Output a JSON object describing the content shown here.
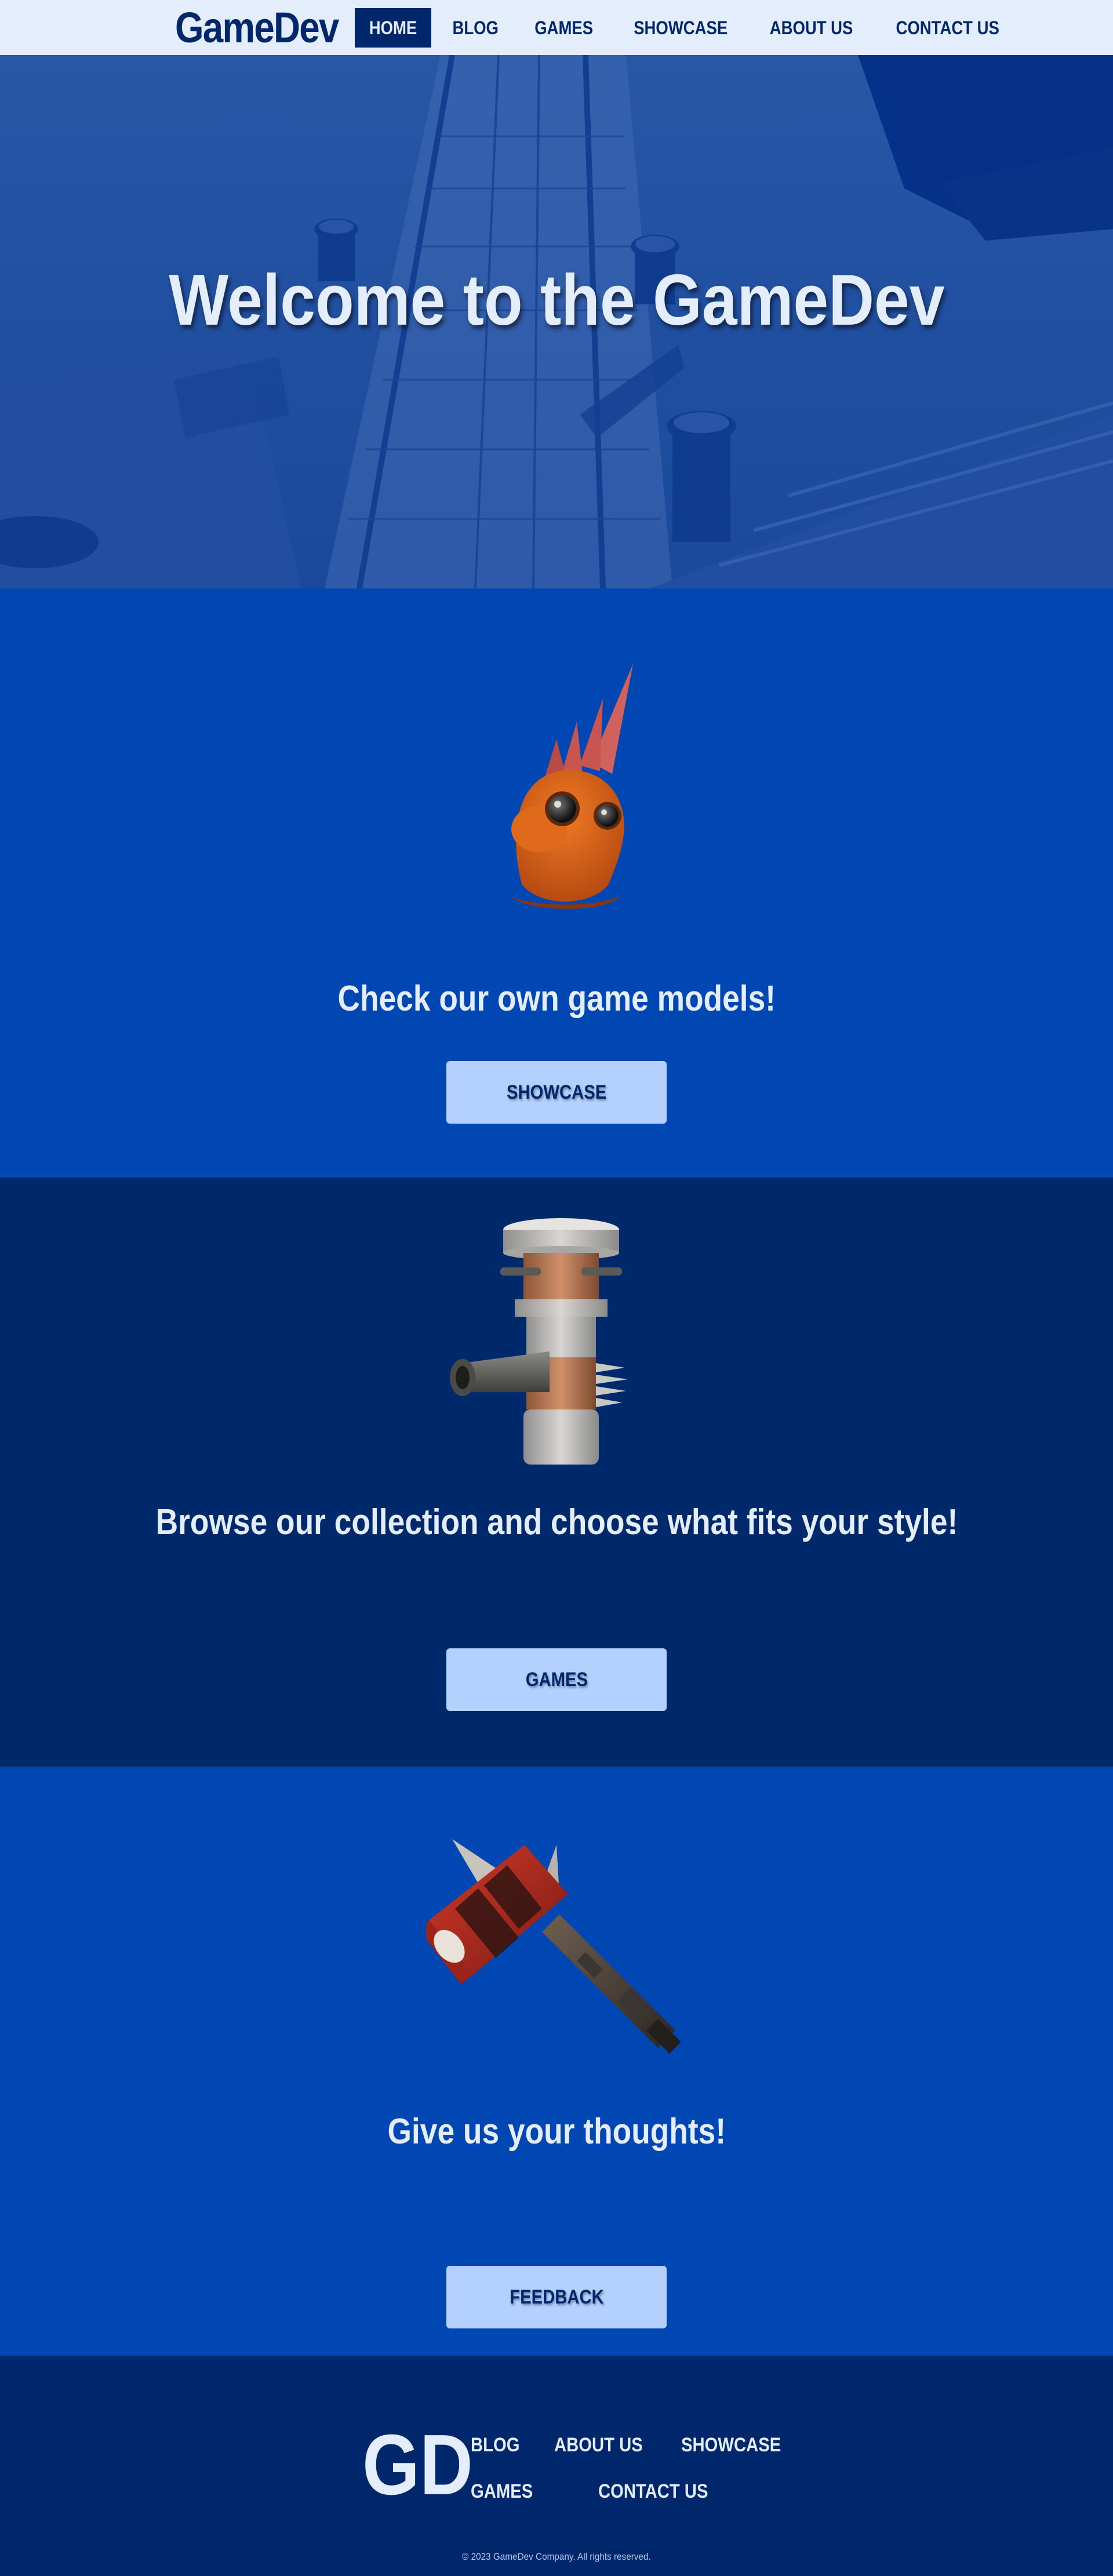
{
  "brand": {
    "logo": "GameDev",
    "footer_logo": "GD"
  },
  "nav": {
    "items": [
      {
        "label": "HOME",
        "active": true
      },
      {
        "label": "BLOG",
        "active": false
      },
      {
        "label": "GAMES",
        "active": false
      },
      {
        "label": "SHOWCASE",
        "active": false
      },
      {
        "label": "ABOUT US",
        "active": false
      },
      {
        "label": "CONTACT US",
        "active": false
      }
    ]
  },
  "hero": {
    "title": "Welcome to the GameDev"
  },
  "sections": [
    {
      "heading": "Check our own game models!",
      "button": "SHOWCASE",
      "model_icon": "orange-creature-icon"
    },
    {
      "heading": "Browse our collection and choose what fits your style!",
      "button": "GAMES",
      "model_icon": "cannon-tower-icon"
    },
    {
      "heading": "Give us your thoughts!",
      "button": "FEEDBACK",
      "model_icon": "spiked-hammer-icon"
    }
  ],
  "footer": {
    "links": [
      "BLOG",
      "ABOUT US",
      "SHOWCASE",
      "GAMES",
      "CONTACT US"
    ],
    "copyright": "© 2023 GameDev Company. All rights reserved."
  },
  "colors": {
    "navbar_bg": "#e3edfc",
    "navy": "#00266b",
    "primary_blue": "#0047b3",
    "dark_blue": "#00296b",
    "button_bg": "#b3d0ff",
    "text_light": "#e3edfc"
  }
}
